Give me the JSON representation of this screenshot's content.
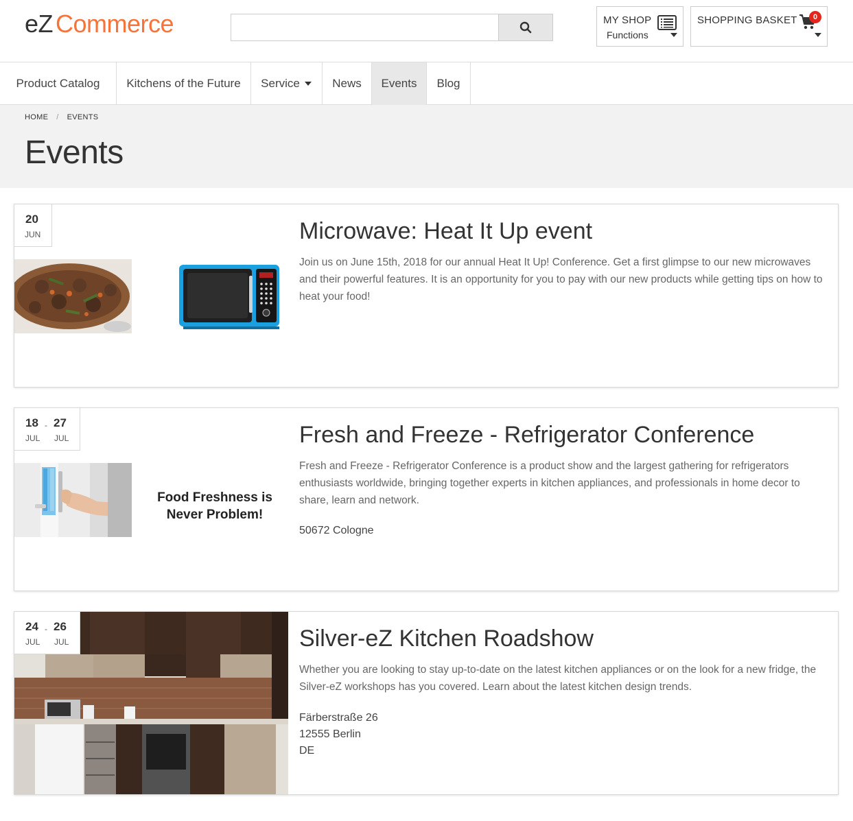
{
  "header": {
    "logo_ez": "eZ",
    "logo_commerce": "Commerce",
    "search_placeholder": "",
    "search_icon": "search-icon",
    "my_shop_label": "MY SHOP",
    "my_shop_sub": "Functions",
    "basket_label": "SHOPPING BASKET",
    "basket_count": "0"
  },
  "nav": {
    "items": [
      {
        "label": "Product Catalog"
      },
      {
        "label": "Kitchens of the Future"
      },
      {
        "label": "Service"
      },
      {
        "label": "News"
      },
      {
        "label": "Events"
      },
      {
        "label": "Blog"
      }
    ],
    "active": "Events"
  },
  "breadcrumb": {
    "home": "HOME",
    "sep": "/",
    "current": "EVENTS"
  },
  "page_title": "Events",
  "events": [
    {
      "start_day": "20",
      "start_month": "JUN",
      "title": "Microwave: Heat It Up event",
      "description": "Join us on June 15th, 2018 for our annual  Heat It Up! Conference.  Get a first glimpse to our new microwaves and their powerful features. It is an opportunity for you to  pay with our new products while getting tips on how to heat your food!"
    },
    {
      "start_day": "18",
      "start_month": "JUL",
      "end_day": "27",
      "end_month": "JUL",
      "range_sep": "-",
      "title": "Fresh and Freeze - Refrigerator Conference",
      "description": "Fresh and Freeze - Refrigerator Conference is a product show and the largest gathering for refrigerators enthusiasts  worldwide, bringing together experts in kitchen appliances, and professionals in home decor to share, learn and network.",
      "image_text_line1": "Food Freshness is",
      "image_text_line2": "Never Problem!",
      "address_line1": "50672 Cologne"
    },
    {
      "start_day": "24",
      "start_month": "JUL",
      "end_day": "26",
      "end_month": "JUL",
      "range_sep": "-",
      "title": "Silver-eZ Kitchen Roadshow",
      "description": "Whether you are looking to stay up-to-date on the latest kitchen appliances or on the look for a new fridge, the Silver-eZ workshops has you covered. Learn about the latest kitchen design trends.",
      "address_line1": "Färberstraße 26",
      "address_line2": "12555 Berlin",
      "address_line3": "DE"
    }
  ]
}
